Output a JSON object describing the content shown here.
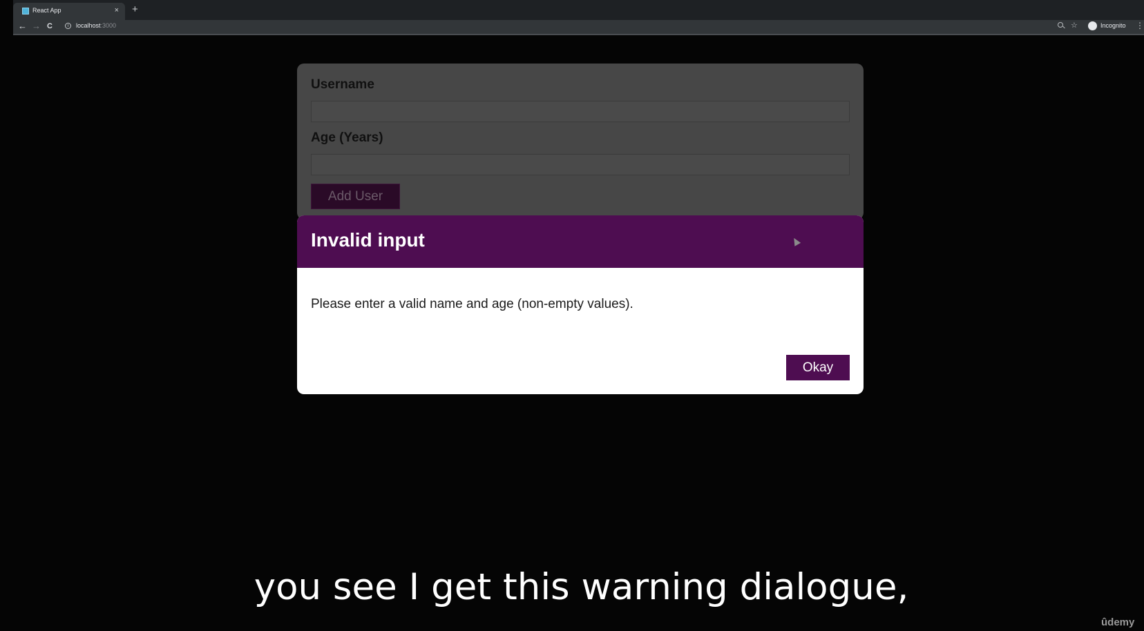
{
  "browser": {
    "tab_title": "React App",
    "tab_close": "×",
    "new_tab": "+",
    "back": "←",
    "forward": "→",
    "reload": "C",
    "info": "i",
    "url_host": "localhost",
    "url_port": ":3000",
    "star": "☆",
    "profile_label": "Incognito",
    "menu": "⋮"
  },
  "form": {
    "username_label": "Username",
    "username_value": "",
    "age_label": "Age (Years)",
    "age_value": "",
    "add_button": "Add User"
  },
  "modal": {
    "title": "Invalid input",
    "message": "Please enter a valid name and age (non-empty values).",
    "okay_button": "Okay"
  },
  "subtitle": "you see I get this warning dialogue,",
  "watermark": "ûdemy",
  "colors": {
    "modal_header": "#4e0d51",
    "button": "#4e0d51",
    "overlay": "#050505"
  }
}
